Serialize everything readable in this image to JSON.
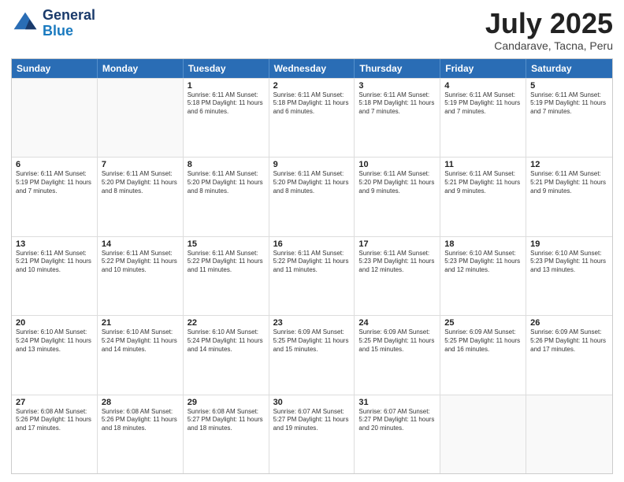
{
  "header": {
    "logo_general": "General",
    "logo_blue": "Blue",
    "title": "July 2025",
    "subtitle": "Candarave, Tacna, Peru"
  },
  "calendar": {
    "days": [
      "Sunday",
      "Monday",
      "Tuesday",
      "Wednesday",
      "Thursday",
      "Friday",
      "Saturday"
    ],
    "rows": [
      [
        {
          "day": "",
          "text": ""
        },
        {
          "day": "",
          "text": ""
        },
        {
          "day": "1",
          "text": "Sunrise: 6:11 AM\nSunset: 5:18 PM\nDaylight: 11 hours and 6 minutes."
        },
        {
          "day": "2",
          "text": "Sunrise: 6:11 AM\nSunset: 5:18 PM\nDaylight: 11 hours and 6 minutes."
        },
        {
          "day": "3",
          "text": "Sunrise: 6:11 AM\nSunset: 5:18 PM\nDaylight: 11 hours and 7 minutes."
        },
        {
          "day": "4",
          "text": "Sunrise: 6:11 AM\nSunset: 5:19 PM\nDaylight: 11 hours and 7 minutes."
        },
        {
          "day": "5",
          "text": "Sunrise: 6:11 AM\nSunset: 5:19 PM\nDaylight: 11 hours and 7 minutes."
        }
      ],
      [
        {
          "day": "6",
          "text": "Sunrise: 6:11 AM\nSunset: 5:19 PM\nDaylight: 11 hours and 7 minutes."
        },
        {
          "day": "7",
          "text": "Sunrise: 6:11 AM\nSunset: 5:20 PM\nDaylight: 11 hours and 8 minutes."
        },
        {
          "day": "8",
          "text": "Sunrise: 6:11 AM\nSunset: 5:20 PM\nDaylight: 11 hours and 8 minutes."
        },
        {
          "day": "9",
          "text": "Sunrise: 6:11 AM\nSunset: 5:20 PM\nDaylight: 11 hours and 8 minutes."
        },
        {
          "day": "10",
          "text": "Sunrise: 6:11 AM\nSunset: 5:20 PM\nDaylight: 11 hours and 9 minutes."
        },
        {
          "day": "11",
          "text": "Sunrise: 6:11 AM\nSunset: 5:21 PM\nDaylight: 11 hours and 9 minutes."
        },
        {
          "day": "12",
          "text": "Sunrise: 6:11 AM\nSunset: 5:21 PM\nDaylight: 11 hours and 9 minutes."
        }
      ],
      [
        {
          "day": "13",
          "text": "Sunrise: 6:11 AM\nSunset: 5:21 PM\nDaylight: 11 hours and 10 minutes."
        },
        {
          "day": "14",
          "text": "Sunrise: 6:11 AM\nSunset: 5:22 PM\nDaylight: 11 hours and 10 minutes."
        },
        {
          "day": "15",
          "text": "Sunrise: 6:11 AM\nSunset: 5:22 PM\nDaylight: 11 hours and 11 minutes."
        },
        {
          "day": "16",
          "text": "Sunrise: 6:11 AM\nSunset: 5:22 PM\nDaylight: 11 hours and 11 minutes."
        },
        {
          "day": "17",
          "text": "Sunrise: 6:11 AM\nSunset: 5:23 PM\nDaylight: 11 hours and 12 minutes."
        },
        {
          "day": "18",
          "text": "Sunrise: 6:10 AM\nSunset: 5:23 PM\nDaylight: 11 hours and 12 minutes."
        },
        {
          "day": "19",
          "text": "Sunrise: 6:10 AM\nSunset: 5:23 PM\nDaylight: 11 hours and 13 minutes."
        }
      ],
      [
        {
          "day": "20",
          "text": "Sunrise: 6:10 AM\nSunset: 5:24 PM\nDaylight: 11 hours and 13 minutes."
        },
        {
          "day": "21",
          "text": "Sunrise: 6:10 AM\nSunset: 5:24 PM\nDaylight: 11 hours and 14 minutes."
        },
        {
          "day": "22",
          "text": "Sunrise: 6:10 AM\nSunset: 5:24 PM\nDaylight: 11 hours and 14 minutes."
        },
        {
          "day": "23",
          "text": "Sunrise: 6:09 AM\nSunset: 5:25 PM\nDaylight: 11 hours and 15 minutes."
        },
        {
          "day": "24",
          "text": "Sunrise: 6:09 AM\nSunset: 5:25 PM\nDaylight: 11 hours and 15 minutes."
        },
        {
          "day": "25",
          "text": "Sunrise: 6:09 AM\nSunset: 5:25 PM\nDaylight: 11 hours and 16 minutes."
        },
        {
          "day": "26",
          "text": "Sunrise: 6:09 AM\nSunset: 5:26 PM\nDaylight: 11 hours and 17 minutes."
        }
      ],
      [
        {
          "day": "27",
          "text": "Sunrise: 6:08 AM\nSunset: 5:26 PM\nDaylight: 11 hours and 17 minutes."
        },
        {
          "day": "28",
          "text": "Sunrise: 6:08 AM\nSunset: 5:26 PM\nDaylight: 11 hours and 18 minutes."
        },
        {
          "day": "29",
          "text": "Sunrise: 6:08 AM\nSunset: 5:27 PM\nDaylight: 11 hours and 18 minutes."
        },
        {
          "day": "30",
          "text": "Sunrise: 6:07 AM\nSunset: 5:27 PM\nDaylight: 11 hours and 19 minutes."
        },
        {
          "day": "31",
          "text": "Sunrise: 6:07 AM\nSunset: 5:27 PM\nDaylight: 11 hours and 20 minutes."
        },
        {
          "day": "",
          "text": ""
        },
        {
          "day": "",
          "text": ""
        }
      ]
    ]
  }
}
